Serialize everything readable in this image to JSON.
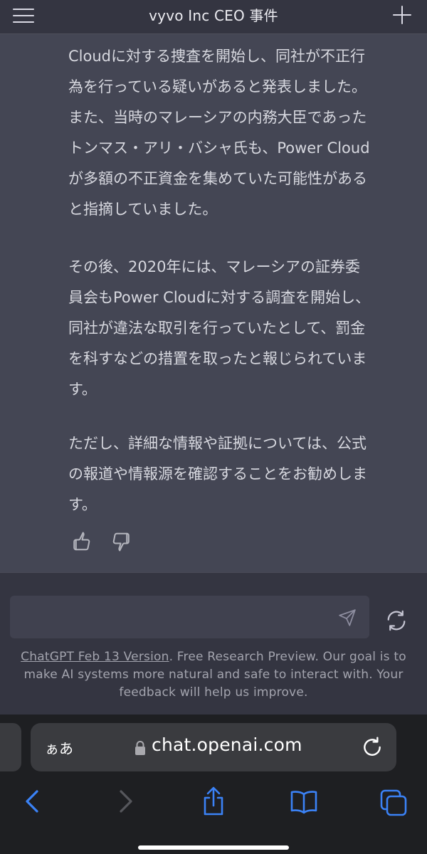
{
  "header": {
    "title": "vyvo Inc CEO 事件",
    "menu_icon": "hamburger-menu-icon",
    "new_chat_icon": "plus-icon"
  },
  "message": {
    "paragraphs": [
      [
        "Cloudに対する捜査を開始し、同社が不正行",
        "為を行っている疑いがあると発表しました。",
        "また、当時のマレーシアの内務大臣であった",
        "トンマス・アリ・バシャ氏も、Power Cloud",
        "が多額の不正資金を集めていた可能性がある",
        "と指摘していました。"
      ],
      [
        "その後、2020年には、マレーシアの証券委",
        "員会もPower Cloudに対する調査を開始し、",
        "同社が違法な取引を行っていたとして、罰金",
        "を科すなどの措置を取ったと報じられていま",
        "す。"
      ],
      [
        "ただし、詳細な情報や証拠については、公式",
        "の報道や情報源を確認することをお勧めしま",
        "す。"
      ]
    ],
    "feedback": {
      "like_icon": "thumbs-up-icon",
      "dislike_icon": "thumbs-down-icon"
    }
  },
  "composer": {
    "input_value": "",
    "send_icon": "send-icon",
    "regenerate_icon": "refresh-icon"
  },
  "disclaimer": {
    "link_text": "ChatGPT Feb 13 Version",
    "text": ". Free Research Preview. Our goal is to make AI systems more natural and safe to interact with. Your feedback will help us improve."
  },
  "browser": {
    "aa_label": "ぁあ",
    "url": "chat.openai.com",
    "toolbar": [
      "back-icon",
      "forward-icon",
      "share-icon",
      "bookmarks-icon",
      "tabs-icon"
    ],
    "accent": "#3b82f6"
  },
  "colors": {
    "page_bg": "#343541",
    "message_bg": "#444654",
    "input_bg": "#40414f",
    "browser_bg": "#1e1f22"
  }
}
